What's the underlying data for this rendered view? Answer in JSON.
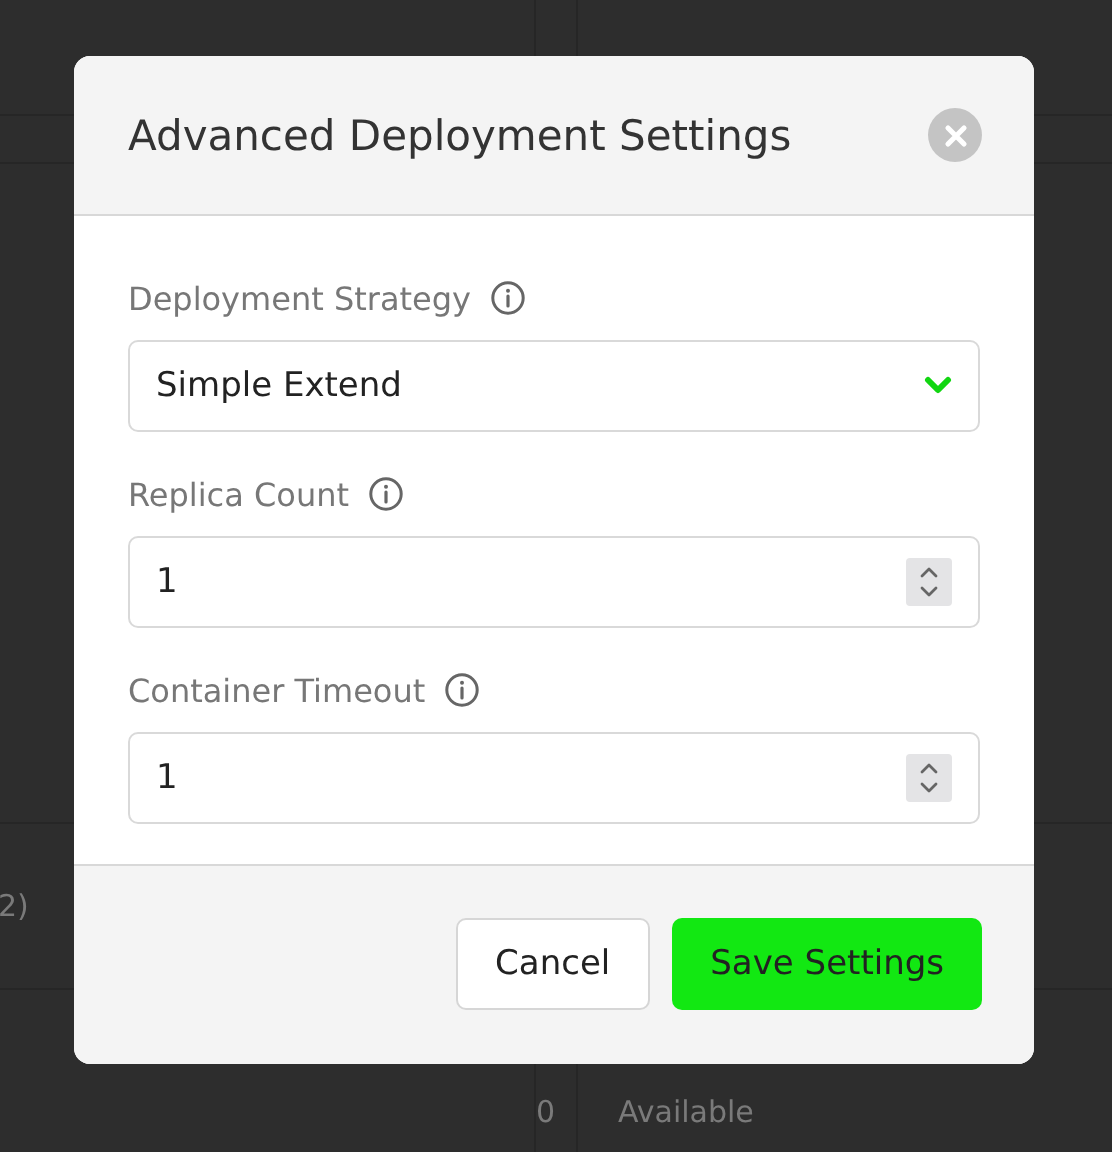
{
  "background_rows": [
    {
      "name": "2)",
      "count": "",
      "status": ""
    },
    {
      "name": "",
      "count": "0",
      "status": "Available"
    }
  ],
  "dialog": {
    "title": "Advanced Deployment Settings",
    "fields": [
      {
        "kind": "select",
        "label": "Deployment Strategy",
        "value": "Simple Extend"
      },
      {
        "kind": "number",
        "label": "Replica Count",
        "value": "1"
      },
      {
        "kind": "number",
        "label": "Container Timeout",
        "value": "1"
      }
    ],
    "buttons": [
      {
        "kind": "secondary",
        "label": "Cancel"
      },
      {
        "kind": "primary",
        "label": "Save Settings"
      }
    ]
  }
}
